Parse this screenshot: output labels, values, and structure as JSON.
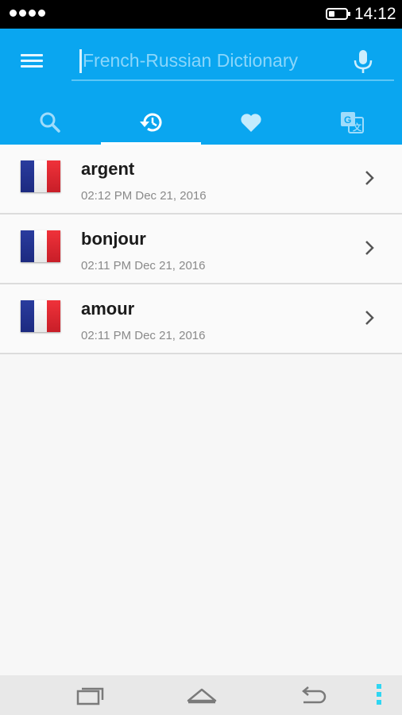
{
  "status_bar": {
    "time": "14:12",
    "signal_icon": "signal-dots-icon",
    "battery_icon": "battery-icon"
  },
  "app_bar": {
    "menu_icon": "hamburger-menu-icon",
    "search": {
      "placeholder": "French-Russian Dictionary",
      "value": ""
    },
    "mic_icon": "microphone-icon",
    "colors": {
      "primary": "#0aa6f0",
      "tab_indicator": "#ffffff"
    }
  },
  "tabs": [
    {
      "id": "search",
      "icon": "search-icon",
      "active": false
    },
    {
      "id": "history",
      "icon": "history-icon",
      "active": true
    },
    {
      "id": "favorites",
      "icon": "heart-icon",
      "active": false
    },
    {
      "id": "translate",
      "icon": "translate-icon",
      "active": false
    }
  ],
  "history": [
    {
      "word": "argent",
      "timestamp": "02:12 PM Dec 21, 2016",
      "flag": "france-flag-icon"
    },
    {
      "word": "bonjour",
      "timestamp": "02:11 PM Dec 21, 2016",
      "flag": "france-flag-icon"
    },
    {
      "word": "amour",
      "timestamp": "02:11 PM Dec 21, 2016",
      "flag": "france-flag-icon"
    }
  ],
  "nav_bar": {
    "recents_icon": "recent-apps-icon",
    "home_icon": "home-icon",
    "back_icon": "back-icon",
    "overflow_icon": "overflow-menu-icon"
  }
}
